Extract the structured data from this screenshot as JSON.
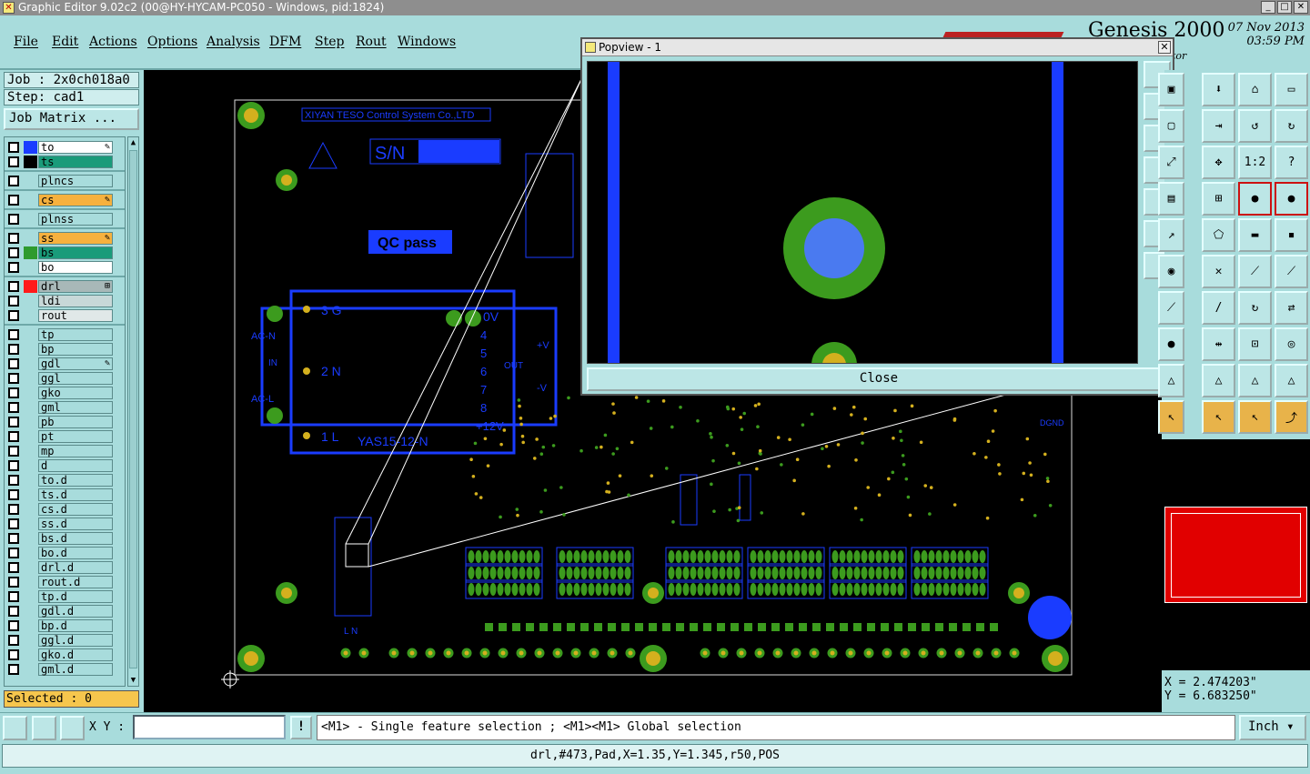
{
  "window": {
    "title": "Graphic Editor 9.02c2 (00@HY-HYCAM-PC050 - Windows, pid:1824)",
    "btn_min": "_",
    "btn_max": "□",
    "btn_close": "✕"
  },
  "menu": [
    "File",
    "Edit",
    "Actions",
    "Options",
    "Analysis",
    "DFM",
    "Step",
    "Rout",
    "Windows"
  ],
  "brand": {
    "product": "Genesis 2000",
    "date": "07 Nov 2013",
    "time": "03:59 PM",
    "subtitle": "tor"
  },
  "job": {
    "job_label": "Job : 2x0ch018a0",
    "step_label": "Step: cad1",
    "matrix_button": "Job Matrix ..."
  },
  "layers": [
    {
      "name": "to",
      "swatch": "#1a3cff",
      "bg": "#ffffff",
      "mark": "✎"
    },
    {
      "name": "ts",
      "swatch": "#000000",
      "bg": "#1a9b7a",
      "mark": ""
    },
    {
      "name": "plncs",
      "swatch": "",
      "bg": "#a8dcdc",
      "mark": ""
    },
    {
      "name": "cs",
      "swatch": "",
      "bg": "#f6b13e",
      "mark": "✎"
    },
    {
      "name": "plnss",
      "swatch": "",
      "bg": "#a8dcdc",
      "mark": ""
    },
    {
      "name": "ss",
      "swatch": "",
      "bg": "#f6b13e",
      "mark": "✎"
    },
    {
      "name": "bs",
      "swatch": "#2e9b2e",
      "bg": "#1a9b7a",
      "mark": ""
    },
    {
      "name": "bo",
      "swatch": "",
      "bg": "#ffffff",
      "mark": ""
    },
    {
      "name": "drl",
      "swatch": "#ff1a1a",
      "bg": "#a8b8b8",
      "mark": "⊞"
    },
    {
      "name": "ldi",
      "swatch": "",
      "bg": "#c8d8d8",
      "mark": ""
    },
    {
      "name": "rout",
      "swatch": "",
      "bg": "#e0e8e8",
      "mark": ""
    },
    {
      "name": "tp",
      "swatch": "",
      "bg": "#a8dcdc",
      "mark": ""
    },
    {
      "name": "bp",
      "swatch": "",
      "bg": "#a8dcdc",
      "mark": ""
    },
    {
      "name": "gdl",
      "swatch": "",
      "bg": "#a8dcdc",
      "mark": "✎"
    },
    {
      "name": "ggl",
      "swatch": "",
      "bg": "#a8dcdc",
      "mark": ""
    },
    {
      "name": "gko",
      "swatch": "",
      "bg": "#a8dcdc",
      "mark": ""
    },
    {
      "name": "gml",
      "swatch": "",
      "bg": "#a8dcdc",
      "mark": ""
    },
    {
      "name": "pb",
      "swatch": "",
      "bg": "#a8dcdc",
      "mark": ""
    },
    {
      "name": "pt",
      "swatch": "",
      "bg": "#a8dcdc",
      "mark": ""
    },
    {
      "name": "mp",
      "swatch": "",
      "bg": "#a8dcdc",
      "mark": ""
    },
    {
      "name": "d",
      "swatch": "",
      "bg": "#a8dcdc",
      "mark": ""
    },
    {
      "name": "to.d",
      "swatch": "",
      "bg": "#a8dcdc",
      "mark": ""
    },
    {
      "name": "ts.d",
      "swatch": "",
      "bg": "#a8dcdc",
      "mark": ""
    },
    {
      "name": "cs.d",
      "swatch": "",
      "bg": "#a8dcdc",
      "mark": ""
    },
    {
      "name": "ss.d",
      "swatch": "",
      "bg": "#a8dcdc",
      "mark": ""
    },
    {
      "name": "bs.d",
      "swatch": "",
      "bg": "#a8dcdc",
      "mark": ""
    },
    {
      "name": "bo.d",
      "swatch": "",
      "bg": "#a8dcdc",
      "mark": ""
    },
    {
      "name": "drl.d",
      "swatch": "",
      "bg": "#a8dcdc",
      "mark": ""
    },
    {
      "name": "rout.d",
      "swatch": "",
      "bg": "#a8dcdc",
      "mark": ""
    },
    {
      "name": "tp.d",
      "swatch": "",
      "bg": "#a8dcdc",
      "mark": ""
    },
    {
      "name": "gdl.d",
      "swatch": "",
      "bg": "#a8dcdc",
      "mark": ""
    },
    {
      "name": "bp.d",
      "swatch": "",
      "bg": "#a8dcdc",
      "mark": ""
    },
    {
      "name": "ggl.d",
      "swatch": "",
      "bg": "#a8dcdc",
      "mark": ""
    },
    {
      "name": "gko.d",
      "swatch": "",
      "bg": "#a8dcdc",
      "mark": ""
    },
    {
      "name": "gml.d",
      "swatch": "",
      "bg": "#a8dcdc",
      "mark": ""
    }
  ],
  "selected": "Selected : 0",
  "board": {
    "company": "XIYAN TESO Control System Co.,LTD",
    "sn_label": "S/N",
    "qc_label": "QC pass",
    "module_name": "YAS15-12-N",
    "pins_left": [
      "3 G",
      "2 N",
      "1 L"
    ],
    "pins_right": [
      "0V",
      "4",
      "5",
      "6",
      "7",
      "8"
    ],
    "plus12": "+12V",
    "acn": "AC-N",
    "acl": "AC-L",
    "in_label": "IN",
    "out_label": "OUT",
    "plusv": "+V",
    "minusv": "-V",
    "dgnd": "DGND",
    "ln": "L  N"
  },
  "popview": {
    "title": "Popview - 1",
    "close_label": "Close"
  },
  "coords": {
    "x": "X = 2.474203\"",
    "y": "Y = 6.683250\""
  },
  "bottom": {
    "xy_label": "X Y :",
    "xy_value": "",
    "excl": "!",
    "hint": "<M1> - Single feature selection ; <M1><M1> Global selection",
    "units": "Inch ▾"
  },
  "status": "drl,#473,Pad,X=1.35,Y=1.345,r50,POS",
  "colors": {
    "accent_teal": "#a8dcdc",
    "board_blue": "#1a3cff",
    "pad_green": "#3c9b1e",
    "pad_yellow": "#d4b01e",
    "preview_red": "#e10000"
  }
}
